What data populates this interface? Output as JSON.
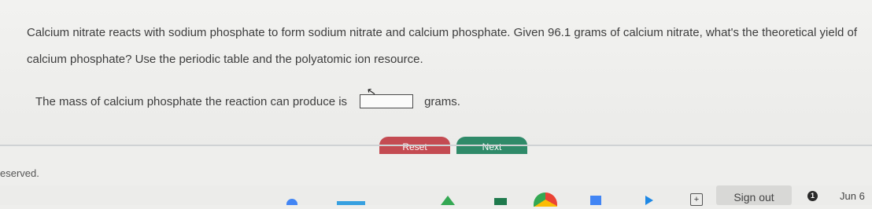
{
  "question": {
    "text": "Calcium nitrate reacts with sodium phosphate to form sodium nitrate and calcium phosphate. Given 96.1 grams of calcium nitrate, what's the theoretical yield of calcium phosphate? Use the periodic table and the polyatomic ion resource."
  },
  "answer": {
    "prompt": "The mass of calcium phosphate the reaction can produce is",
    "value": "",
    "unit": "grams."
  },
  "buttons": {
    "reset": "Reset",
    "next": "Next"
  },
  "footer": {
    "text": "eserved."
  },
  "taskbar": {
    "sign_out": "Sign out",
    "notification_count": "1",
    "date": "Jun 6"
  }
}
